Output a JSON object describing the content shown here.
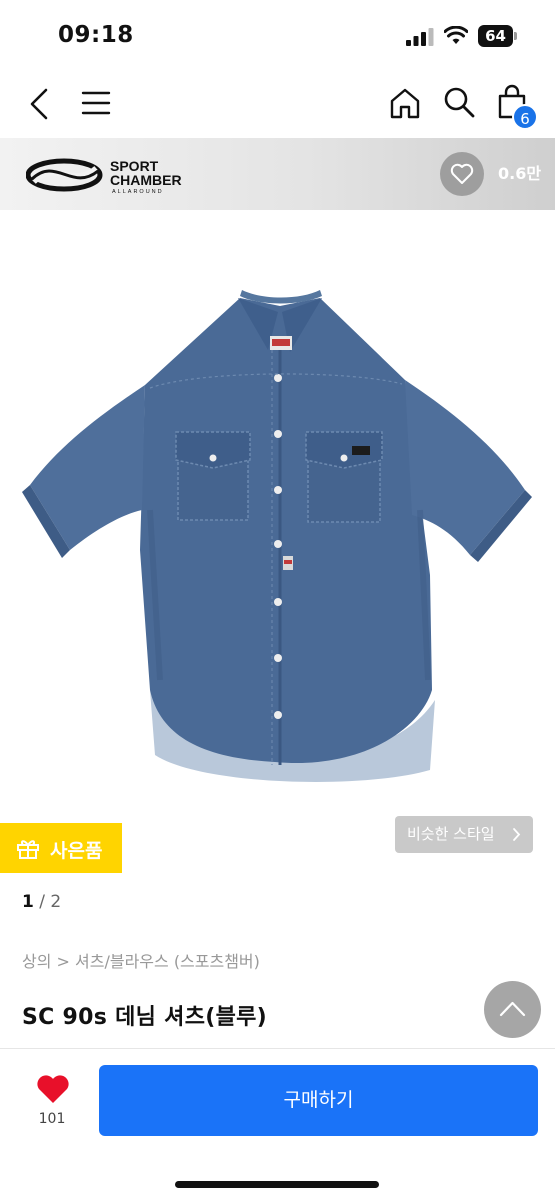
{
  "status": {
    "time": "09:18",
    "battery": "64",
    "icons": [
      "signal-icon",
      "wifi-icon",
      "battery-icon"
    ]
  },
  "nav": {
    "icons": [
      "back-icon",
      "menu-icon",
      "home-icon",
      "search-icon",
      "cart-icon"
    ],
    "cart_count": "6"
  },
  "brand": {
    "name": "SPORT CHAMBER",
    "tagline": "ALLAROUND",
    "like_count": "0.6만",
    "icon": "heart-outline-icon"
  },
  "product": {
    "image_alt": "denim-shirt-image",
    "gift_label": "사은품",
    "similar_style_label": "비슷한 스타일",
    "pager_current": "1",
    "pager_total": "2",
    "breadcrumb": "상의 > 셔츠/블라우스 (스포츠챔버)",
    "title": "SC 90s 데님 셔츠(블루)"
  },
  "bottom": {
    "wish_count": "101",
    "buy_label": "구매하기"
  },
  "colors": {
    "accent_blue": "#1a73f8",
    "gift_yellow": "#ffd400",
    "wish_red": "#e8102a",
    "denim": "#4a6a96"
  }
}
